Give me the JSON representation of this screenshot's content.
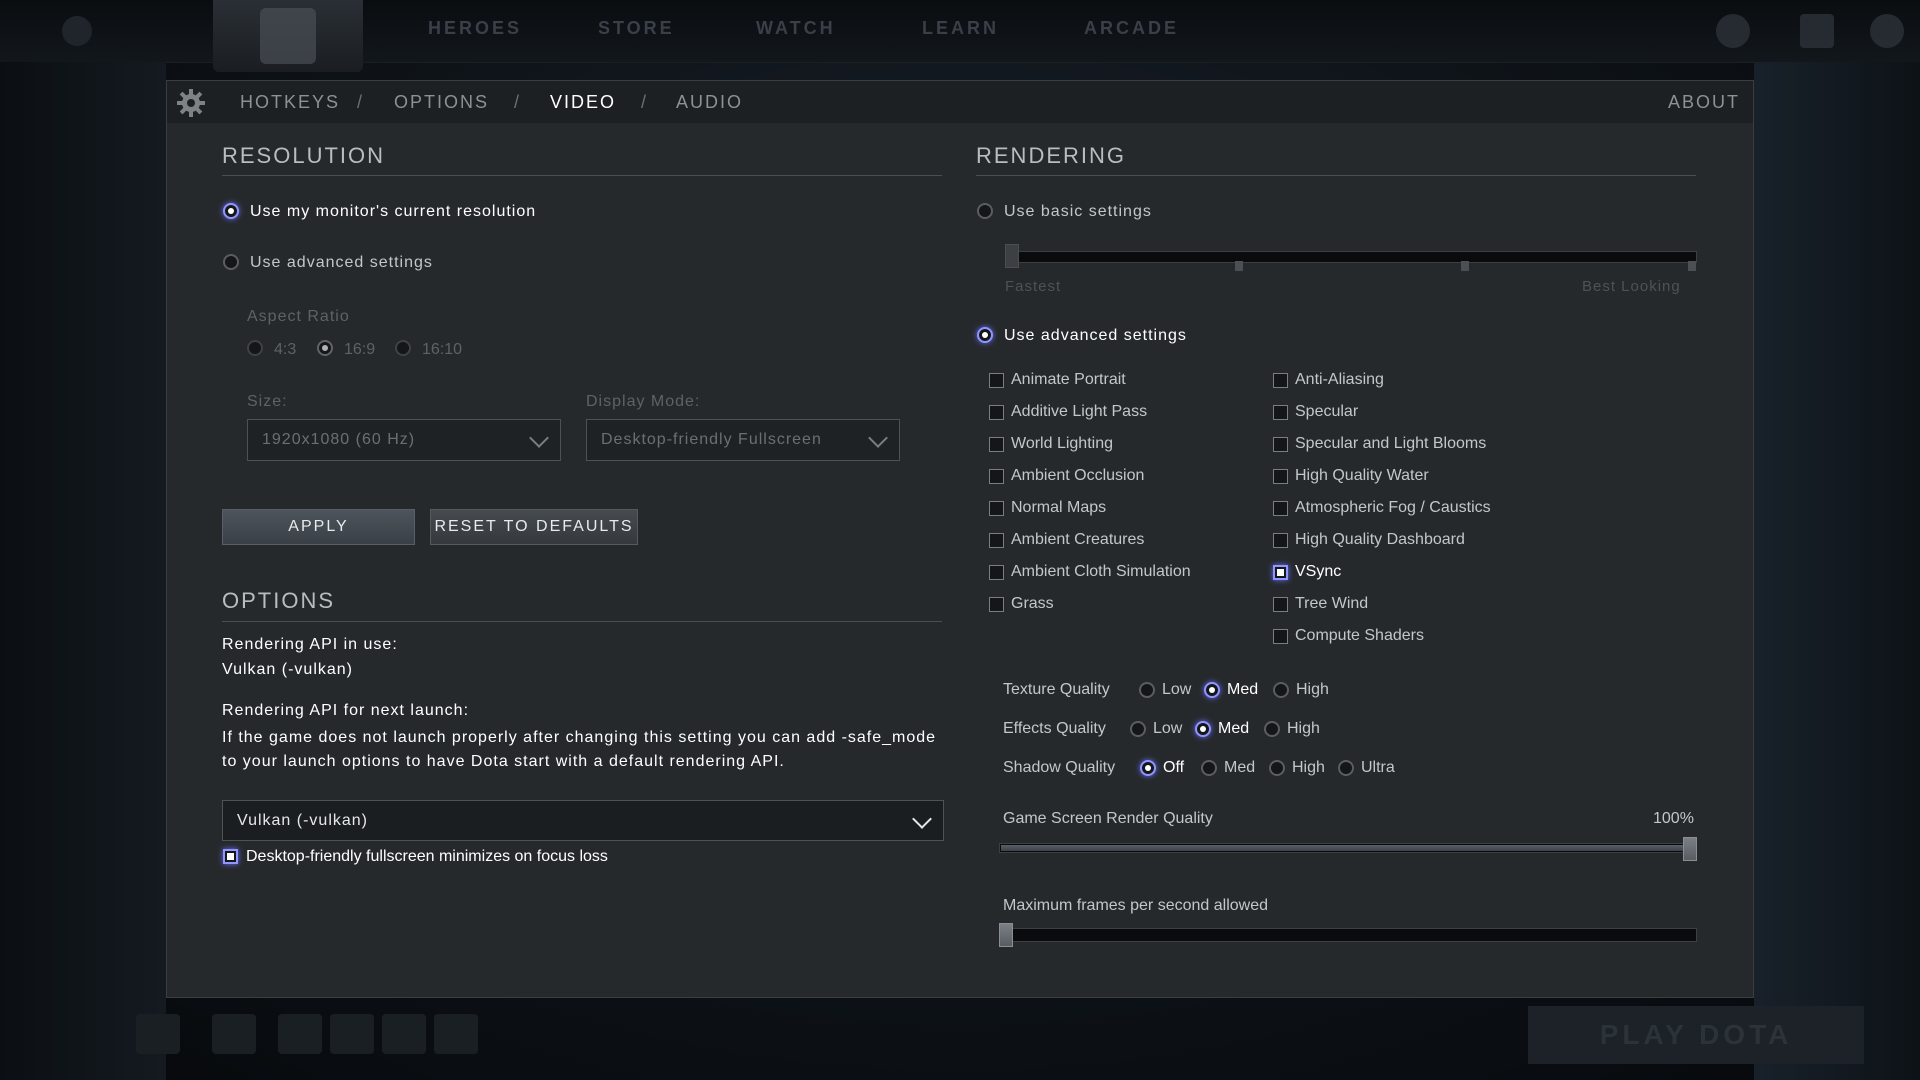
{
  "window": {
    "title": "VIDEO"
  },
  "top_nav": {
    "items": [
      "HEROES",
      "STORE",
      "WATCH",
      "LEARN",
      "ARCADE"
    ]
  },
  "tabs": [
    {
      "label": "HOTKEYS",
      "active": false
    },
    {
      "label": "OPTIONS",
      "active": false
    },
    {
      "label": "VIDEO",
      "active": true
    },
    {
      "label": "AUDIO",
      "active": false
    }
  ],
  "tab_separator": "/",
  "about_label": "ABOUT",
  "resolution": {
    "title": "RESOLUTION",
    "use_monitor_label": "Use my monitor's current resolution",
    "use_advanced_label": "Use advanced settings",
    "selected": "use_monitor",
    "aspect_ratio_label": "Aspect Ratio",
    "aspect_options": [
      "4:3",
      "16:9",
      "16:10"
    ],
    "aspect_selected": "16:9",
    "size_label": "Size:",
    "size_value": "1920x1080 (60 Hz)",
    "display_mode_label": "Display Mode:",
    "display_mode_value": "Desktop-friendly Fullscreen",
    "apply_label": "APPLY",
    "reset_label": "RESET TO DEFAULTS"
  },
  "options": {
    "title": "OPTIONS",
    "api_in_use_label": "Rendering API in use:",
    "api_in_use_value": "Vulkan (-vulkan)",
    "api_next_label": "Rendering API for next launch:",
    "api_next_help": "If the game does not launch properly after changing this setting you can add -safe_mode to your launch options to have Dota start with a default rendering API.",
    "api_next_value": "Vulkan (-vulkan)",
    "minimize_label": "Desktop-friendly fullscreen minimizes on focus loss",
    "minimize_checked": true
  },
  "rendering": {
    "title": "RENDERING",
    "basic_label": "Use basic settings",
    "basic_slider_min_label": "Fastest",
    "basic_slider_max_label": "Best Looking",
    "advanced_label": "Use advanced settings",
    "selected": "advanced",
    "checkboxes_left": [
      {
        "label": "Animate Portrait",
        "checked": false
      },
      {
        "label": "Additive Light Pass",
        "checked": false
      },
      {
        "label": "World Lighting",
        "checked": false
      },
      {
        "label": "Ambient Occlusion",
        "checked": false
      },
      {
        "label": "Normal Maps",
        "checked": false
      },
      {
        "label": "Ambient Creatures",
        "checked": false
      },
      {
        "label": "Ambient Cloth Simulation",
        "checked": false
      },
      {
        "label": "Grass",
        "checked": false
      }
    ],
    "checkboxes_right": [
      {
        "label": "Anti-Aliasing",
        "checked": false
      },
      {
        "label": "Specular",
        "checked": false
      },
      {
        "label": "Specular and Light Blooms",
        "checked": false
      },
      {
        "label": "High Quality Water",
        "checked": false
      },
      {
        "label": "Atmospheric Fog / Caustics",
        "checked": false
      },
      {
        "label": "High Quality Dashboard",
        "checked": false
      },
      {
        "label": "VSync",
        "checked": true
      },
      {
        "label": "Tree Wind",
        "checked": false
      },
      {
        "label": "Compute Shaders",
        "checked": false
      }
    ],
    "texture_quality": {
      "label": "Texture Quality",
      "options": [
        "Low",
        "Med",
        "High"
      ],
      "selected": "Med"
    },
    "effects_quality": {
      "label": "Effects Quality",
      "options": [
        "Low",
        "Med",
        "High"
      ],
      "selected": "Med"
    },
    "shadow_quality": {
      "label": "Shadow Quality",
      "options": [
        "Off",
        "Med",
        "High",
        "Ultra"
      ],
      "selected": "Off"
    },
    "render_quality_label": "Game Screen Render Quality",
    "render_quality_value": "100%",
    "render_quality_fraction": 1.0,
    "max_fps_label": "Maximum frames per second allowed",
    "max_fps_fraction": 0.0
  },
  "play_label": "PLAY DOTA",
  "colors": {
    "accent": "#8f96ff",
    "panel": "#26292c",
    "header": "#1d2023"
  }
}
